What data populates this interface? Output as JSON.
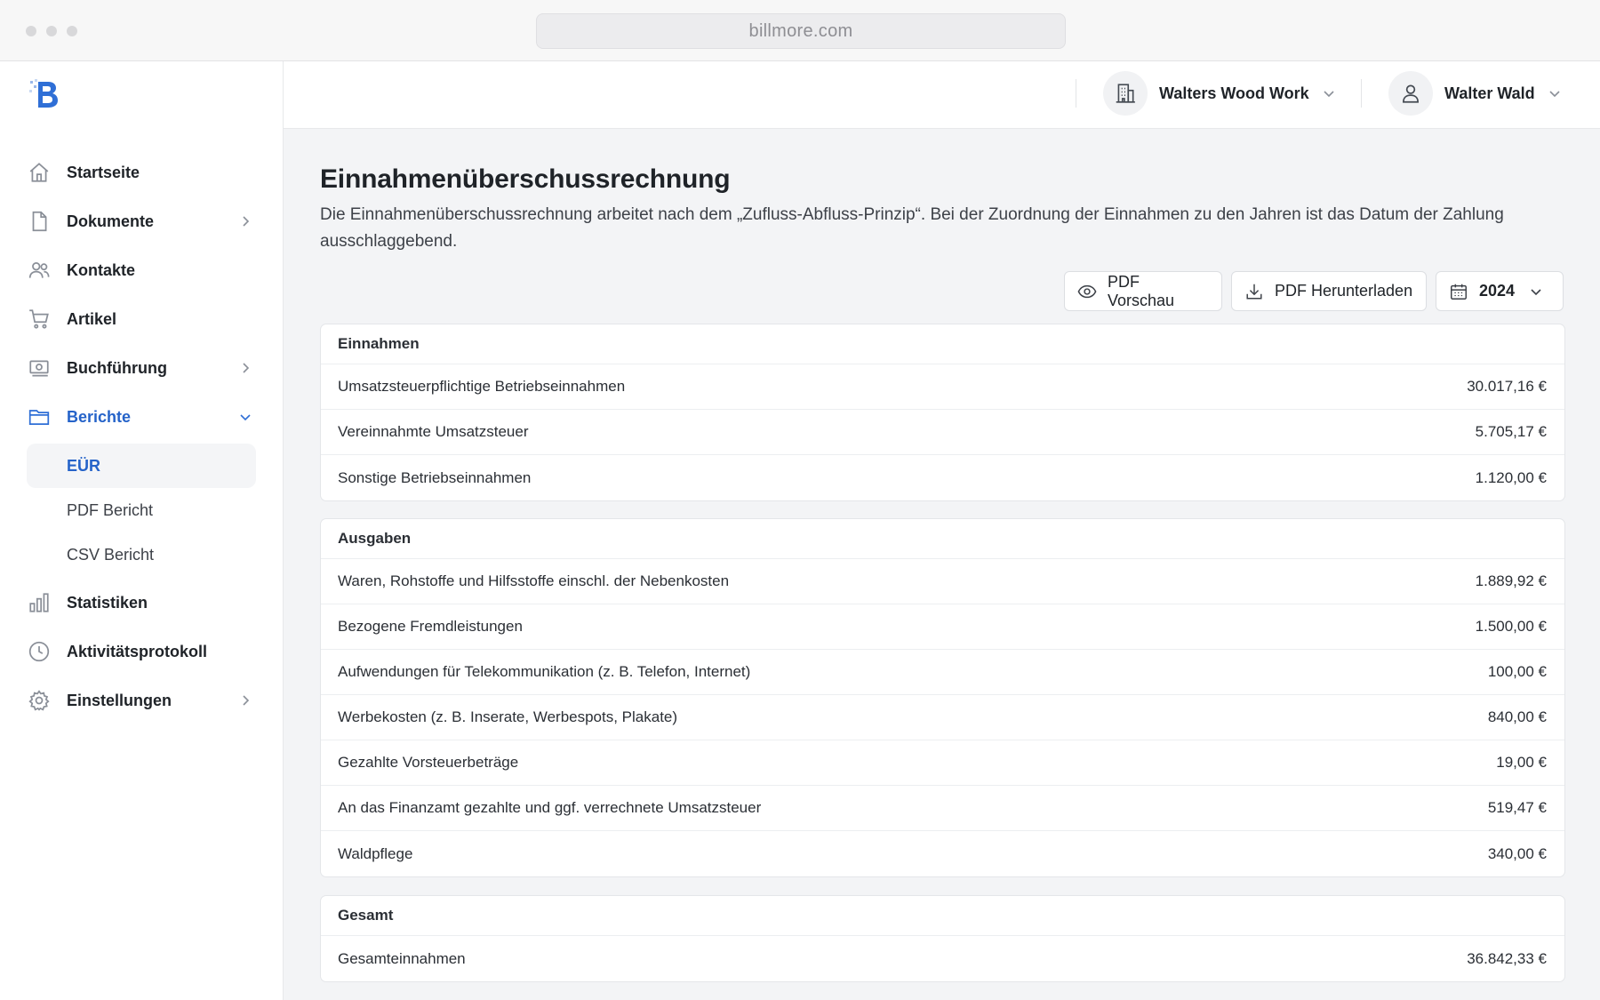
{
  "browser": {
    "url": "billmore.com"
  },
  "sidebar": {
    "logo": "billmore-logo",
    "items": [
      {
        "label": "Startseite",
        "icon": "home-icon"
      },
      {
        "label": "Dokumente",
        "icon": "document-icon"
      },
      {
        "label": "Kontakte",
        "icon": "users-icon"
      },
      {
        "label": "Artikel",
        "icon": "cart-icon"
      },
      {
        "label": "Buchführung",
        "icon": "cash-icon"
      },
      {
        "label": "Berichte",
        "icon": "folder-icon"
      },
      {
        "label": "Statistiken",
        "icon": "bar-chart-icon"
      },
      {
        "label": "Aktivitätsprotokoll",
        "icon": "clock-icon"
      },
      {
        "label": "Einstellungen",
        "icon": "gear-icon"
      }
    ],
    "sub_items": [
      {
        "label": "EÜR",
        "active": true
      },
      {
        "label": "PDF Bericht",
        "active": false
      },
      {
        "label": "CSV Bericht",
        "active": false
      }
    ],
    "active_color": "#2563c9"
  },
  "topbar": {
    "company": "Walters Wood Work",
    "user": "Walter Wald"
  },
  "main": {
    "title": "Einnahmenüberschussrechnung",
    "description": "Die Einnahmenüberschussrechnung arbeitet nach dem „Zufluss-Abfluss-Prinzip“. Bei der Zuordnung der Einnahmen zu den Jahren ist das Datum der Zahlung ausschlaggebend.",
    "buttons": {
      "preview": "PDF Vorschau",
      "download": "PDF Herunterladen",
      "year": "2024"
    },
    "sections": [
      {
        "title": "Einnahmen",
        "rows": [
          {
            "label": "Umsatzsteuerpflichtige Betriebseinnahmen",
            "amount": "30.017,16 €"
          },
          {
            "label": "Vereinnahmte Umsatzsteuer",
            "amount": "5.705,17 €"
          },
          {
            "label": "Sonstige Betriebseinnahmen",
            "amount": "1.120,00 €"
          }
        ]
      },
      {
        "title": "Ausgaben",
        "rows": [
          {
            "label": "Waren, Rohstoffe und Hilfsstoffe einschl. der Nebenkosten",
            "amount": "1.889,92 €"
          },
          {
            "label": "Bezogene Fremdleistungen",
            "amount": "1.500,00 €"
          },
          {
            "label": "Aufwendungen für Telekommunikation (z. B. Telefon, Internet)",
            "amount": "100,00 €"
          },
          {
            "label": "Werbekosten (z. B. Inserate, Werbespots, Plakate)",
            "amount": "840,00 €"
          },
          {
            "label": "Gezahlte Vorsteuerbeträge",
            "amount": "19,00 €"
          },
          {
            "label": "An das Finanzamt gezahlte und ggf. verrechnete Umsatzsteuer",
            "amount": "519,47 €"
          },
          {
            "label": "Waldpflege",
            "amount": "340,00 €"
          }
        ]
      },
      {
        "title": "Gesamt",
        "rows": [
          {
            "label": "Gesamteinnahmen",
            "amount": "36.842,33 €"
          }
        ]
      }
    ]
  }
}
